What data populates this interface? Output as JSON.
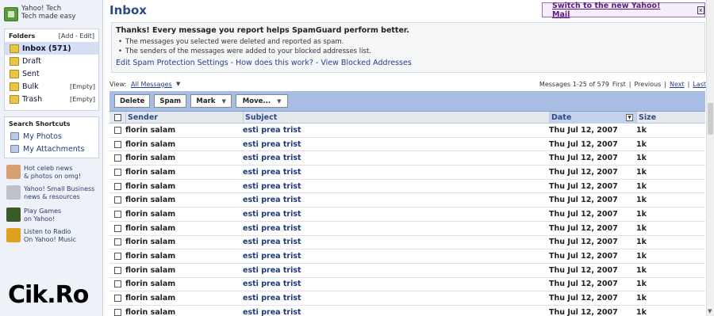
{
  "sidebar": {
    "promo_top": {
      "line1": "Yahoo! Tech",
      "line2": "Tech made easy"
    },
    "folders": {
      "title": "Folders",
      "links": "[Add - Edit]",
      "items": [
        {
          "name": "Inbox (571)",
          "action": "",
          "icon": "inbox-icon"
        },
        {
          "name": "Draft",
          "action": "",
          "icon": "draft-icon"
        },
        {
          "name": "Sent",
          "action": "",
          "icon": "sent-icon"
        },
        {
          "name": "Bulk",
          "action": "[Empty]",
          "icon": "bulk-icon"
        },
        {
          "name": "Trash",
          "action": "[Empty]",
          "icon": "trash-icon"
        }
      ]
    },
    "shortcuts": {
      "title": "Search Shortcuts",
      "items": [
        {
          "name": "My Photos",
          "icon": "photos-icon"
        },
        {
          "name": "My Attachments",
          "icon": "attachments-icon"
        }
      ]
    },
    "promos": [
      {
        "line1": "Hot celeb news",
        "line2": "& photos on omg!",
        "color": "#d8a070"
      },
      {
        "line1": "Yahoo! Small Business",
        "line2": "news & resources",
        "color": "#c0c0c8"
      },
      {
        "line1": "Play Games",
        "line2": "on Yahoo!",
        "color": "#3a5a2a"
      },
      {
        "line1": "Listen to Radio",
        "line2": "On Yahoo! Music",
        "color": "#e0a020"
      }
    ],
    "brand": "Cik.Ro"
  },
  "main": {
    "title": "Inbox",
    "switch_link": "Switch to the new Yahoo! Mail",
    "close_symbol": "x",
    "notice": {
      "title": "Thanks! Every message you report helps SpamGuard perform better.",
      "bullets": [
        "The messages you selected were deleted and reported as spam.",
        "The senders of the messages were added to your blocked addresses list."
      ],
      "link1": "Edit Spam Protection Settings",
      "sep1": " - ",
      "link2": "How does this work?",
      "sep2": " - ",
      "link3": "View Blocked Addresses"
    },
    "view": {
      "label": "View:",
      "selected": "All Messages"
    },
    "pager": {
      "range": "Messages 1-25 of 579",
      "first": "First",
      "sep": "|",
      "previous": "Previous",
      "next": "Next",
      "last": "Last"
    },
    "toolbar": {
      "delete": "Delete",
      "spam": "Spam",
      "mark": "Mark",
      "move": "Move..."
    },
    "columns": {
      "sender": "Sender",
      "subject": "Subject",
      "date": "Date",
      "size": "Size"
    },
    "rows": [
      {
        "sender": "florin salam",
        "subject": "esti prea trist",
        "date": "Thu Jul 12, 2007",
        "size": "1k"
      },
      {
        "sender": "florin salam",
        "subject": "esti prea trist",
        "date": "Thu Jul 12, 2007",
        "size": "1k"
      },
      {
        "sender": "florin salam",
        "subject": "esti prea trist",
        "date": "Thu Jul 12, 2007",
        "size": "1k"
      },
      {
        "sender": "florin salam",
        "subject": "esti prea trist",
        "date": "Thu Jul 12, 2007",
        "size": "1k"
      },
      {
        "sender": "florin salam",
        "subject": "esti prea trist",
        "date": "Thu Jul 12, 2007",
        "size": "1k"
      },
      {
        "sender": "florin salam",
        "subject": "esti prea trist",
        "date": "Thu Jul 12, 2007",
        "size": "1k"
      },
      {
        "sender": "florin salam",
        "subject": "esti prea trist",
        "date": "Thu Jul 12, 2007",
        "size": "1k"
      },
      {
        "sender": "florin salam",
        "subject": "esti prea trist",
        "date": "Thu Jul 12, 2007",
        "size": "1k"
      },
      {
        "sender": "florin salam",
        "subject": "esti prea trist",
        "date": "Thu Jul 12, 2007",
        "size": "1k"
      },
      {
        "sender": "florin salam",
        "subject": "esti prea trist",
        "date": "Thu Jul 12, 2007",
        "size": "1k"
      },
      {
        "sender": "florin salam",
        "subject": "esti prea trist",
        "date": "Thu Jul 12, 2007",
        "size": "1k"
      },
      {
        "sender": "florin salam",
        "subject": "esti prea trist",
        "date": "Thu Jul 12, 2007",
        "size": "1k"
      },
      {
        "sender": "florin salam",
        "subject": "esti prea trist",
        "date": "Thu Jul 12, 2007",
        "size": "1k"
      },
      {
        "sender": "florin salam",
        "subject": "esti prea trist",
        "date": "Thu Jul 12, 2007",
        "size": "1k"
      }
    ]
  }
}
